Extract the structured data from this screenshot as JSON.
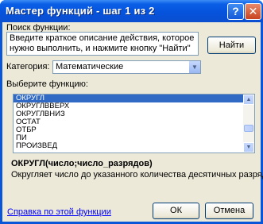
{
  "window": {
    "title": "Мастер функций - шаг 1 из 2",
    "help_glyph": "?",
    "close_glyph": "✕"
  },
  "search": {
    "label": "Поиск функции:",
    "field_text": "Введите краткое описание действия, которое нужно выполнить, и нажмите кнопку \"Найти\"",
    "button_label": "Найти"
  },
  "category": {
    "label": "Категория:",
    "selected": "Математические"
  },
  "function_list": {
    "label": "Выберите функцию:",
    "items": [
      "ОКРУГЛ",
      "ОКРУГЛВВЕРХ",
      "ОКРУГЛВНИЗ",
      "ОСТАТ",
      "ОТБР",
      "ПИ",
      "ПРОИЗВЕД"
    ],
    "selected": "ОКРУГЛ"
  },
  "details": {
    "signature": "ОКРУГЛ(число;число_разрядов)",
    "description": "Округляет число до указанного количества десятичных разрядов."
  },
  "footer": {
    "help_link": "Справка по этой функции",
    "ok_label": "ОК",
    "cancel_label": "Отмена"
  }
}
